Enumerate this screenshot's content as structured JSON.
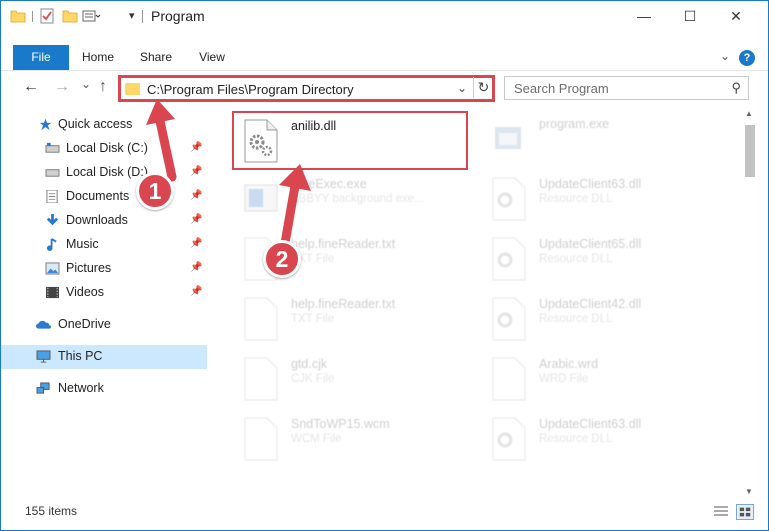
{
  "window": {
    "title": "Program",
    "controls": {
      "minimize": "—",
      "maximize": "☐",
      "close": "✕"
    }
  },
  "ribbon": {
    "tabs": [
      "File",
      "Home",
      "Share",
      "View"
    ],
    "collapse": "⌄",
    "help": "?"
  },
  "nav": {
    "back": "←",
    "forward": "→",
    "recent": "⌄",
    "up": "↑"
  },
  "address": {
    "path": "C:\\Program Files\\Program Directory",
    "dropdown": "⌄",
    "refresh": "↻"
  },
  "search": {
    "placeholder": "Search Program",
    "icon": "⚲"
  },
  "sidebar": {
    "items": [
      {
        "label": "Quick access",
        "icon": "star-icon"
      },
      {
        "label": "Local Disk (C:)",
        "icon": "drive-icon",
        "pinned": true
      },
      {
        "label": "Local Disk (D:)",
        "icon": "drive-icon",
        "pinned": true
      },
      {
        "label": "Documents",
        "icon": "documents-icon",
        "pinned": true
      },
      {
        "label": "Downloads",
        "icon": "downloads-icon",
        "pinned": true
      },
      {
        "label": "Music",
        "icon": "music-icon",
        "pinned": true
      },
      {
        "label": "Pictures",
        "icon": "pictures-icon",
        "pinned": true
      },
      {
        "label": "Videos",
        "icon": "videos-icon",
        "pinned": true
      },
      {
        "label": "OneDrive",
        "icon": "onedrive-icon"
      },
      {
        "label": "This PC",
        "icon": "this-pc-icon",
        "selected": true
      },
      {
        "label": "Network",
        "icon": "network-icon"
      }
    ],
    "pin_glyph": "📌"
  },
  "files": [
    {
      "name": "anilib.dll",
      "type": "",
      "icon": "dll-file-icon",
      "selected": true
    },
    {
      "name": "program.exe",
      "type": "",
      "icon": "exe-file-icon"
    },
    {
      "name": "FineExec.exe",
      "type": "ABBYY background exe...",
      "icon": "exe-file-icon"
    },
    {
      "name": "UpdateClient63.dll",
      "type": "Resource DLL",
      "icon": "dll-file-icon"
    },
    {
      "name": "help.fineReader.txt",
      "type": "TXT File",
      "icon": "text-file-icon"
    },
    {
      "name": "UpdateClient65.dll",
      "type": "Resource DLL",
      "icon": "dll-file-icon"
    },
    {
      "name": "help.fineReader.txt",
      "type": "TXT File",
      "icon": "text-file-icon"
    },
    {
      "name": "UpdateClient42.dll",
      "type": "Resource DLL",
      "icon": "dll-file-icon"
    },
    {
      "name": "gtd.cjk",
      "type": "CJK File",
      "icon": "generic-file-icon"
    },
    {
      "name": "Arabic.wrd",
      "type": "WRD File",
      "icon": "generic-file-icon"
    },
    {
      "name": "SndToWP15.wcm",
      "type": "WCM File",
      "icon": "generic-file-icon"
    },
    {
      "name": "UpdateClient63.dll",
      "type": "Resource DLL",
      "icon": "dll-file-icon"
    }
  ],
  "status": {
    "count": "155 items"
  },
  "steps": [
    "1",
    "2"
  ],
  "colors": {
    "accent": "#1979ca",
    "highlight": "#d9464f",
    "selection": "#cce8ff"
  }
}
